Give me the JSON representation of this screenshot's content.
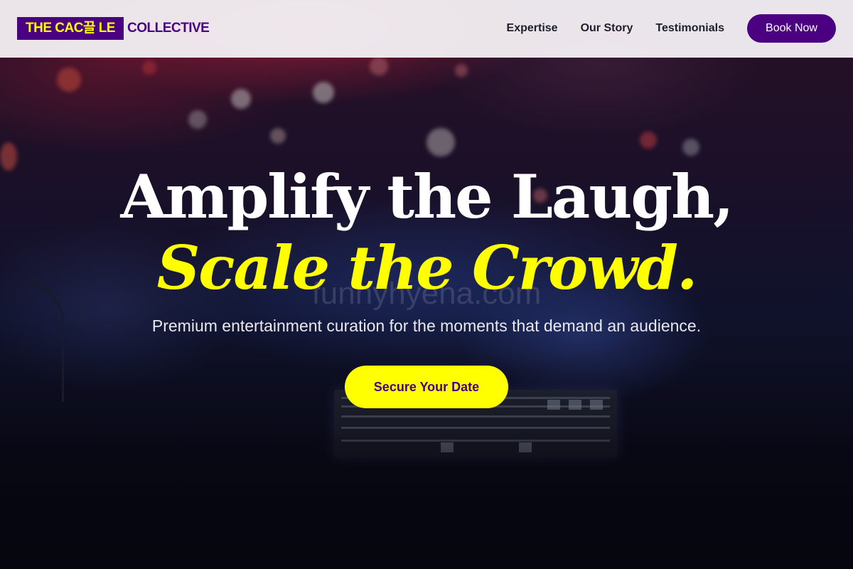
{
  "header": {
    "logo_highlight": "THE CAC끌 LE",
    "logo_rest": "COLLECTIVE",
    "nav_links": [
      "Expertise",
      "Our Story",
      "Testimonials"
    ],
    "cta_label": "Book Now"
  },
  "hero": {
    "headline_line1": "Amplify the Laugh,",
    "headline_line2": "Scale the Crowd.",
    "subtitle": "Premium entertainment curation for the moments that demand an audience.",
    "cta_label": "Secure Your Date",
    "watermark": "funnyhyena.com"
  },
  "colors": {
    "brand_purple": "#4b0082",
    "accent_yellow": "#ffff00",
    "nav_bg": "#f3eef3",
    "text_light": "#e8e8ee"
  }
}
